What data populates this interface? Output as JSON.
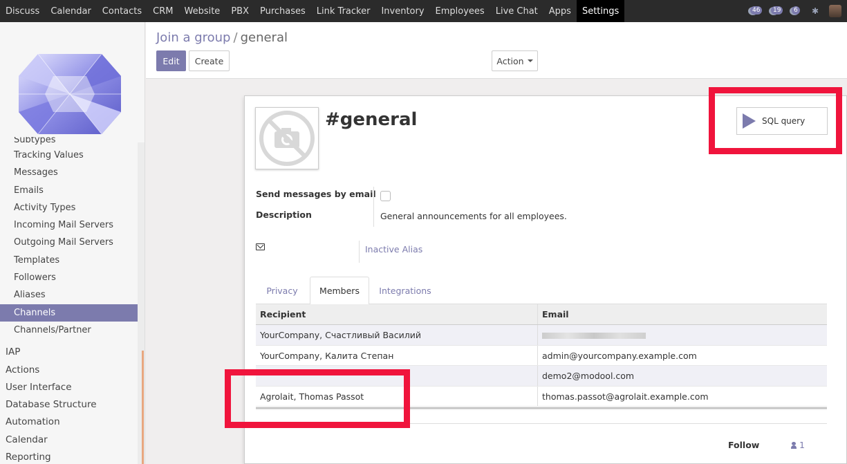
{
  "topbar": {
    "menu": [
      "Discuss",
      "Calendar",
      "Contacts",
      "CRM",
      "Website",
      "PBX",
      "Purchases",
      "Link Tracker",
      "Inventory",
      "Employees",
      "Live Chat",
      "Apps",
      "Settings"
    ],
    "active": "Settings",
    "badges": {
      "activities": "46",
      "messages": "19",
      "chat": "6"
    }
  },
  "sidebar": {
    "items": [
      {
        "label": "Subtypes",
        "level": "sub"
      },
      {
        "label": "Tracking Values",
        "level": "sub"
      },
      {
        "label": "Messages",
        "level": "sub"
      },
      {
        "label": "Emails",
        "level": "sub"
      },
      {
        "label": "Activity Types",
        "level": "sub"
      },
      {
        "label": "Incoming Mail Servers",
        "level": "sub"
      },
      {
        "label": "Outgoing Mail Servers",
        "level": "sub"
      },
      {
        "label": "Templates",
        "level": "sub"
      },
      {
        "label": "Followers",
        "level": "sub"
      },
      {
        "label": "Aliases",
        "level": "sub"
      },
      {
        "label": "Channels",
        "level": "sub",
        "active": true
      },
      {
        "label": "Channels/Partner",
        "level": "sub"
      },
      {
        "label": "IAP",
        "level": "top"
      },
      {
        "label": "Actions",
        "level": "top"
      },
      {
        "label": "User Interface",
        "level": "top"
      },
      {
        "label": "Database Structure",
        "level": "top"
      },
      {
        "label": "Automation",
        "level": "top"
      },
      {
        "label": "Calendar",
        "level": "top"
      },
      {
        "label": "Reporting",
        "level": "top"
      }
    ]
  },
  "breadcrumb": {
    "parent": "Join a group",
    "separator": "/",
    "current": "general"
  },
  "buttons": {
    "edit": "Edit",
    "create": "Create",
    "action": "Action",
    "sql": "SQL query"
  },
  "record": {
    "title": "#general",
    "send_by_email_label": "Send messages by email",
    "description_label": "Description",
    "description": "General announcements for all employees.",
    "alias": "Inactive Alias"
  },
  "tabs": [
    "Privacy",
    "Members",
    "Integrations"
  ],
  "active_tab": "Members",
  "members": {
    "headers": [
      "Recipient",
      "Email"
    ],
    "rows": [
      {
        "recipient": "YourCompany, Счастливый Василий",
        "email": ""
      },
      {
        "recipient": "YourCompany, Калита Степан",
        "email": "admin@yourcompany.example.com"
      },
      {
        "recipient": "",
        "email": "demo2@modool.com"
      },
      {
        "recipient": "Agrolait, Thomas Passot",
        "email": "thomas.passot@agrolait.example.com"
      }
    ]
  },
  "chatter": {
    "follow": "Follow",
    "followers_count": "1"
  },
  "colors": {
    "accent": "#7c7bad",
    "highlight": "#f0143c",
    "topbar": "#2b2b2b"
  }
}
